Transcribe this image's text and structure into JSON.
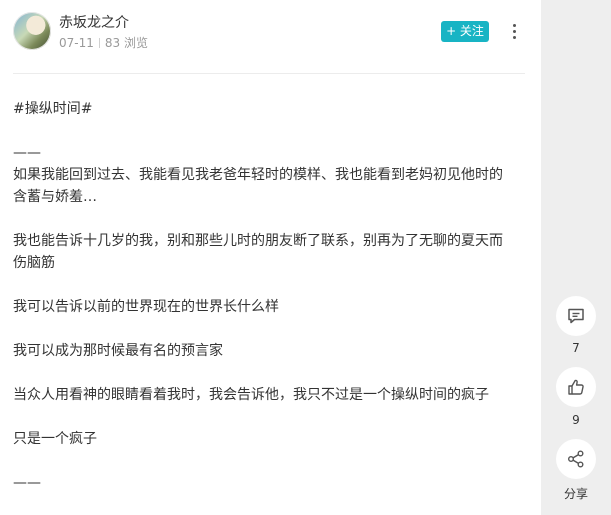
{
  "author": {
    "name": "赤坂龙之介",
    "date": "07-11",
    "views": "83 浏览"
  },
  "actions": {
    "follow_label": "+ 关注"
  },
  "post": {
    "lines": [
      "#操纵时间#",
      "——",
      "如果我能回到过去、我能看见我老爸年轻时的模样、我也能看到老妈初见他时的",
      "含蓄与娇羞…",
      "我也能告诉十几岁的我，别和那些儿时的朋友断了联系，别再为了无聊的夏天而",
      "伤脑筋",
      "我可以告诉以前的世界现在的世界长什么样",
      "我可以成为那时候最有名的预言家",
      "当众人用看神的眼睛看着我时，我会告诉他，我只不过是一个操纵时间的疯子",
      "只是一个疯子",
      "——"
    ]
  },
  "sidebar": {
    "comment": {
      "icon": "comment-icon",
      "count": "7"
    },
    "like": {
      "icon": "thumbs-up-icon",
      "count": "9"
    },
    "share": {
      "icon": "share-icon",
      "label": "分享"
    }
  },
  "colors": {
    "accent": "#18b4c4",
    "sidebar_bg": "#eeeeee",
    "meta_text": "#999999"
  }
}
